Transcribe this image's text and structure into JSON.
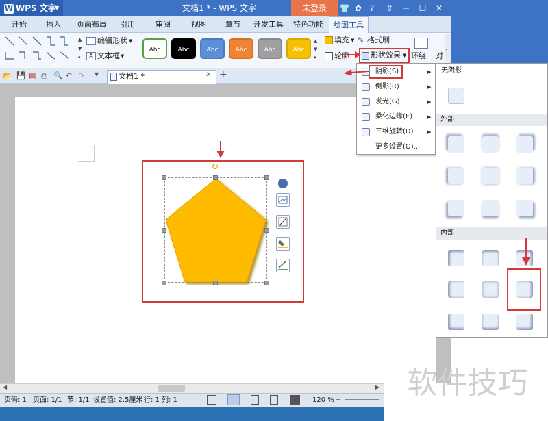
{
  "titlebar": {
    "app_name": "WPS 文字",
    "app_glyph": "W",
    "doc_title": "文档1 * - WPS 文字",
    "login": "未登录"
  },
  "tabs": [
    "开始",
    "插入",
    "页面布局",
    "引用",
    "审阅",
    "视图",
    "章节",
    "开发工具",
    "特色功能",
    "绘图工具"
  ],
  "ribbon": {
    "edit_shape": "编辑形状",
    "text_box": "文本框",
    "styles": [
      {
        "label": "Abc",
        "bg": "#ffffff",
        "fg": "#222222",
        "border": "#5a9e45"
      },
      {
        "label": "Abc",
        "bg": "#000000",
        "fg": "#ffffff",
        "border": "#000000"
      },
      {
        "label": "Abc",
        "bg": "#5b8fd6",
        "fg": "#ffffff",
        "border": "#4a7cc0"
      },
      {
        "label": "Abc",
        "bg": "#ee8433",
        "fg": "#ffffff",
        "border": "#d4702a"
      },
      {
        "label": "Abc",
        "bg": "#a0a0a0",
        "fg": "#ffffff",
        "border": "#888888"
      },
      {
        "label": "Abc",
        "bg": "#f5c000",
        "fg": "#ffffff",
        "border": "#d9a800"
      }
    ],
    "fill": "填充",
    "format_brush": "格式刷",
    "outline": "轮廓",
    "shape_effects": "形状效果",
    "wrap": "环绕",
    "align": "对"
  },
  "doc_tab": "文档1 *",
  "menu1": {
    "items": [
      {
        "label": "阴影(S)",
        "has_sub": true
      },
      {
        "label": "倒影(R)",
        "has_sub": true
      },
      {
        "label": "发光(G)",
        "has_sub": true
      },
      {
        "label": "柔化边缘(E)",
        "has_sub": true
      },
      {
        "label": "三维旋转(D)",
        "has_sub": true
      },
      {
        "label": "更多设置(O)...",
        "has_sub": false
      }
    ]
  },
  "menu2": {
    "no_shadow": "无阴影",
    "outer": "外部",
    "inner": "内部"
  },
  "statusbar": {
    "page_code": "页码: 1",
    "pages": "页面: 1/1",
    "section": "节: 1/1",
    "setting": "设置值: 2.5厘米",
    "row": "行: 1",
    "col": "列: 1",
    "zoom": "120 %"
  },
  "watermark": "软件技巧",
  "colors": {
    "pentagon": "#ffbb00",
    "accent": "#3e72c4",
    "highlight": "#d23b3b"
  }
}
